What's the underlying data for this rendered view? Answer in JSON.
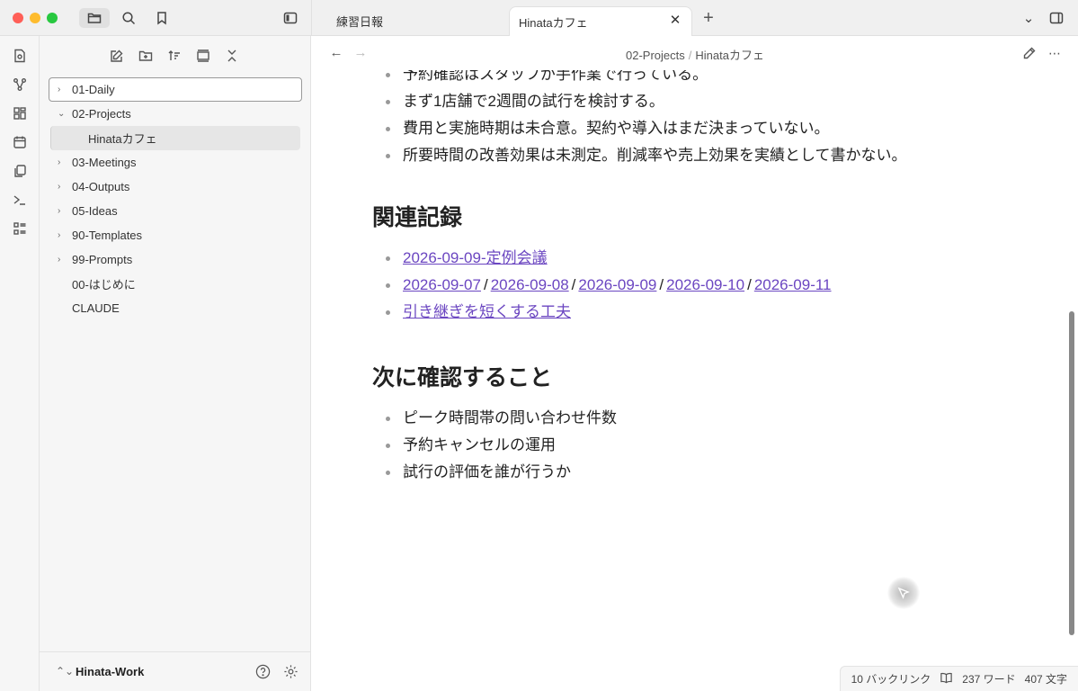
{
  "tabs": [
    {
      "label": "練習日報"
    },
    {
      "label": "Hinataカフェ"
    }
  ],
  "tab_close_glyph": "✕",
  "tab_new_glyph": "+",
  "tab_menu_glyph": "⌄",
  "sidebar": {
    "tree": [
      {
        "label": "01-Daily",
        "chevron": "›"
      },
      {
        "label": "02-Projects",
        "chevron": "⌄"
      },
      {
        "label": "Hinataカフェ"
      },
      {
        "label": "03-Meetings",
        "chevron": "›"
      },
      {
        "label": "04-Outputs",
        "chevron": "›"
      },
      {
        "label": "05-Ideas",
        "chevron": "›"
      },
      {
        "label": "90-Templates",
        "chevron": "›"
      },
      {
        "label": "99-Prompts",
        "chevron": "›"
      },
      {
        "label": "00-はじめに"
      },
      {
        "label": "CLAUDE"
      }
    ],
    "vault": {
      "name": "Hinata-Work",
      "switch_glyph": "⌃⌄"
    }
  },
  "editor": {
    "breadcrumb": {
      "folder": "02-Projects",
      "separator": "/",
      "file": "Hinataカフェ"
    },
    "nav": {
      "back": "←",
      "forward": "→"
    },
    "more_glyph": "⋯",
    "top_bullets": [
      "予約確認はスタッフが手作業で行っている。",
      "まず1店舗で2週間の試行を検討する。",
      "費用と実施時期は未合意。契約や導入はまだ決まっていない。",
      "所要時間の改善効果は未測定。削減率や売上効果を実績として書かない。"
    ],
    "related": {
      "heading": "関連記録",
      "meeting_link": "2026-09-09-定例会議",
      "daily_links": [
        "2026-09-07",
        "2026-09-08",
        "2026-09-09",
        "2026-09-10",
        "2026-09-11"
      ],
      "slash": "/",
      "tip_link": "引き継ぎを短くする工夫"
    },
    "next": {
      "heading": "次に確認すること",
      "items": [
        "ピーク時間帯の問い合わせ件数",
        "予約キャンセルの運用",
        "試行の評価を誰が行うか"
      ]
    }
  },
  "status_bar": {
    "backlinks": "10 バックリンク",
    "words": "237 ワード",
    "chars": "407 文字"
  },
  "colors": {
    "link": "#6b46c1",
    "traffic_red": "#ff5f57",
    "traffic_yellow": "#febc2e",
    "traffic_green": "#28c840"
  }
}
